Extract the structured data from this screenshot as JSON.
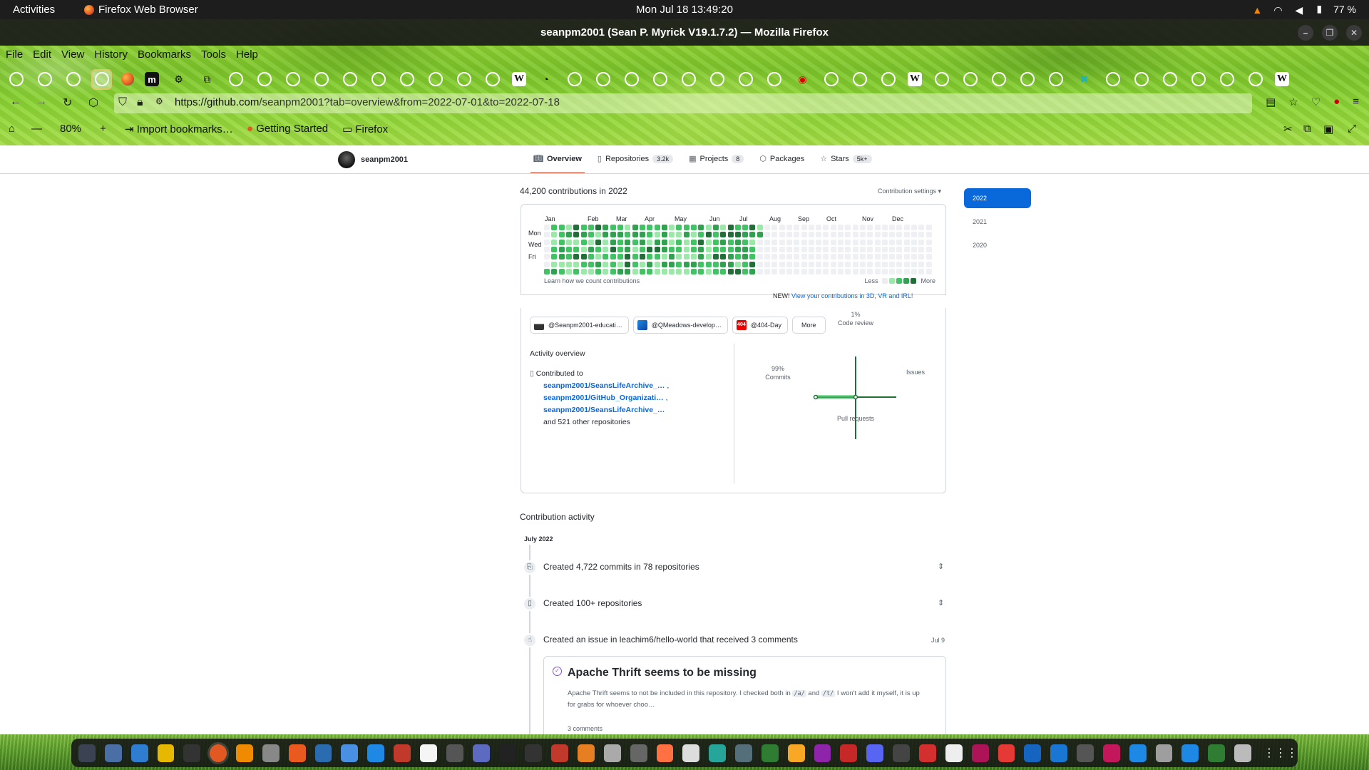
{
  "system": {
    "activities": "Activities",
    "app_name": "Firefox Web Browser",
    "clock": "Mon Jul 18  13:49:20",
    "battery": "77 %"
  },
  "window": {
    "title": "seanpm2001 (Sean P. Myrick V19.1.7.2) — Mozilla Firefox"
  },
  "menu": [
    "File",
    "Edit",
    "View",
    "History",
    "Bookmarks",
    "Tools",
    "Help"
  ],
  "navbar": {
    "url_domain": "https://github.com",
    "url_path": "/seanpm2001?tab=overview&from=2022-07-01&to=2022-07-18"
  },
  "bookmarks_bar": {
    "zoom": "80%",
    "zoom_minus": "—",
    "zoom_plus": "+",
    "import": "Import bookmarks…",
    "getting_started": "Getting Started",
    "firefox_folder": "Firefox"
  },
  "github": {
    "username": "seanpm2001",
    "tabs": [
      {
        "label": "Overview",
        "count": ""
      },
      {
        "label": "Repositories",
        "count": "3.2k"
      },
      {
        "label": "Projects",
        "count": "8"
      },
      {
        "label": "Packages",
        "count": ""
      },
      {
        "label": "Stars",
        "count": "5k+"
      }
    ],
    "contributions_title": "44,200 contributions in 2022",
    "contribution_settings": "Contribution settings ▾",
    "months": [
      "Jan",
      "Feb",
      "Mar",
      "Apr",
      "May",
      "Jun",
      "Jul",
      "Aug",
      "Sep",
      "Oct",
      "Nov",
      "Dec"
    ],
    "days": [
      "Mon",
      "Wed",
      "Fri"
    ],
    "learn_link": "Learn how we count contributions",
    "legend_less": "Less",
    "legend_more": "More",
    "new_prefix": "NEW!",
    "new_link": "View your contributions in 3D, VR and IRL!",
    "orgs": [
      "@Seanpm2001-educati…",
      "@QMeadows-develop…",
      "@404-Day"
    ],
    "org_icon_text": "404",
    "more_button": "More",
    "activity_overview": "Activity overview",
    "contributed_to": "Contributed to",
    "repos": [
      "seanpm2001/SeansLifeArchive_…",
      "seanpm2001/GitHub_Organizati…",
      "seanpm2001/SeansLifeArchive_…"
    ],
    "repo_separators": [
      ",",
      ","
    ],
    "other_repos": "and 521 other repositories",
    "axes": {
      "code_review_pct": "1%",
      "code_review": "Code review",
      "commits_pct": "99%",
      "commits": "Commits",
      "issues": "Issues",
      "pull_requests": "Pull requests"
    },
    "activity_title": "Contribution activity",
    "month_label": "July 2022",
    "events": [
      {
        "text": "Created 4,722 commits in 78 repositories"
      },
      {
        "text": "Created 100+ repositories"
      },
      {
        "text": "Created an issue in leachim6/hello-world that received 3 comments",
        "date": "Jul 9"
      }
    ],
    "issue": {
      "title": "Apache Thrift seems to be missing",
      "body_1": "Apache Thrift seems to not be included in this repository. I checked both in ",
      "code_a": "/a/",
      "body_and": " and ",
      "code_t": "/t/",
      "body_2": " I won't add it myself, it is up for grabs for whoever choo…",
      "comments": "3 comments"
    },
    "years": [
      "2022",
      "2021",
      "2020"
    ]
  },
  "colors": {
    "gh_blue": "#0969da",
    "contrib_levels": [
      "#ebedf0",
      "#9be9a8",
      "#40c463",
      "#30a14e",
      "#216e39"
    ]
  }
}
